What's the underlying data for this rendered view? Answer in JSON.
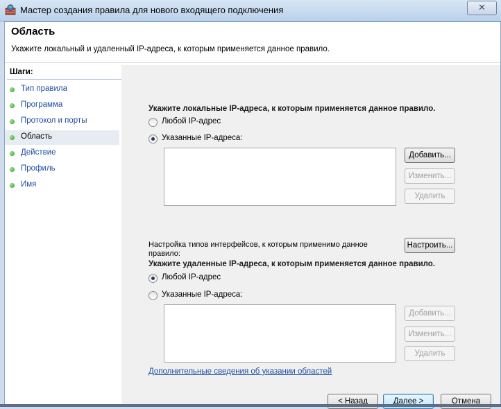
{
  "window": {
    "title": "Мастер создания правила для нового входящего подключения",
    "close_glyph": "✕"
  },
  "header": {
    "title": "Область",
    "subtitle": "Укажите локальный и удаленный IP-адреса, к которым применяется данное правило."
  },
  "steps": {
    "title": "Шаги:",
    "items": [
      {
        "label": "Тип правила",
        "active": false
      },
      {
        "label": "Программа",
        "active": false
      },
      {
        "label": "Протокол и порты",
        "active": false
      },
      {
        "label": "Область",
        "active": true
      },
      {
        "label": "Действие",
        "active": false
      },
      {
        "label": "Профиль",
        "active": false
      },
      {
        "label": "Имя",
        "active": false
      }
    ]
  },
  "local": {
    "heading": "Укажите локальные IP-адреса, к которым применяется данное правило.",
    "any_label": "Любой IP-адрес",
    "specific_label": "Указанные IP-адреса:",
    "selected": "specific",
    "add_button": "Добавить...",
    "edit_button": "Изменить...",
    "remove_button": "Удалить"
  },
  "interfaces": {
    "text": "Настройка типов интерфейсов, к которым применимо данное правило:",
    "button": "Настроить..."
  },
  "remote": {
    "heading": "Укажите удаленные IP-адреса, к которым применяется данное правило.",
    "any_label": "Любой IP-адрес",
    "specific_label": "Указанные IP-адреса:",
    "selected": "any",
    "add_button": "Добавить...",
    "edit_button": "Изменить...",
    "remove_button": "Удалить"
  },
  "help_link": "Дополнительные сведения об указании областей",
  "footer": {
    "back_button": "< Назад",
    "next_button": "Далее >",
    "cancel_button": "Отмена"
  },
  "icons": [
    "firewall-wizard-icon",
    "close-icon",
    "step-dot-icon"
  ]
}
